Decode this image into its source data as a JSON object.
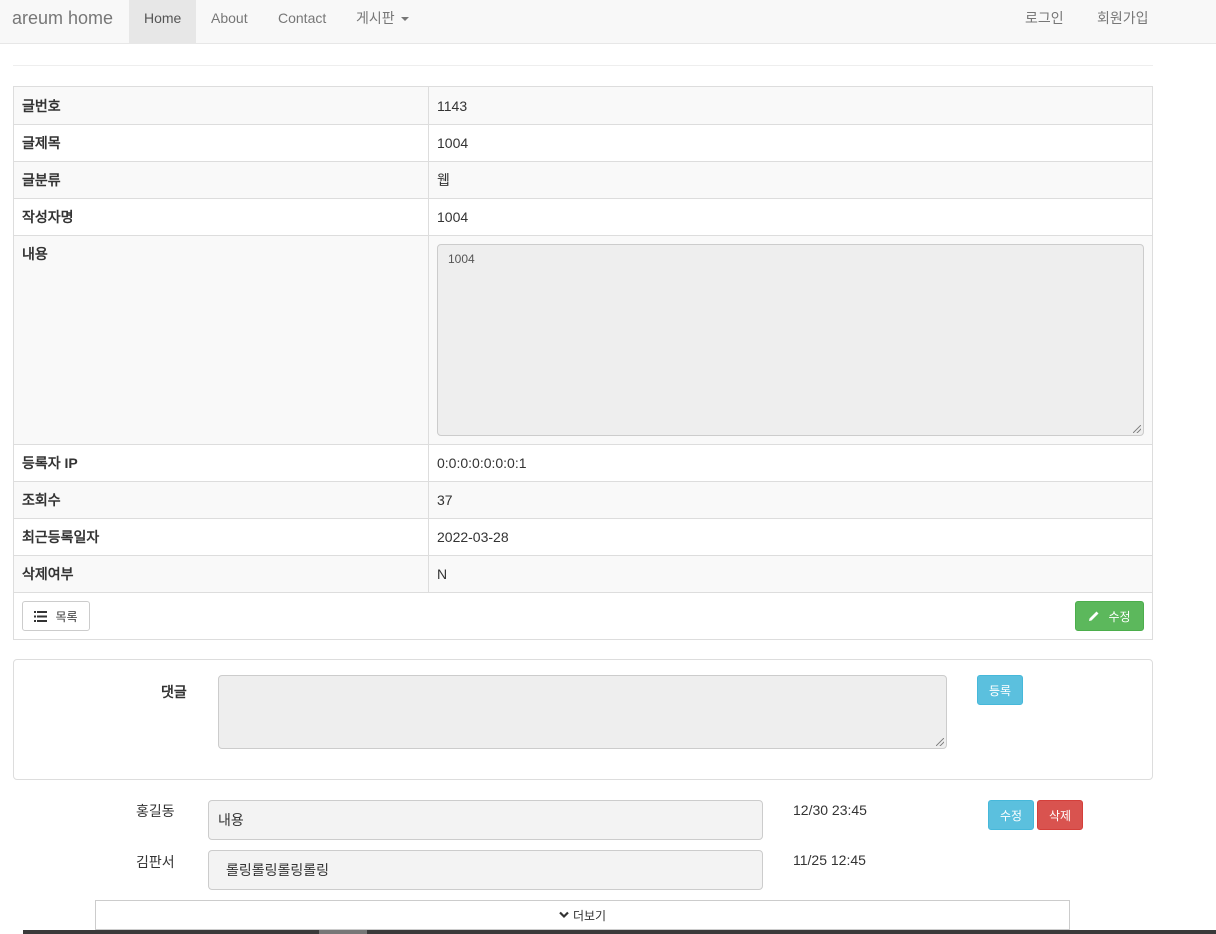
{
  "navbar": {
    "brand": "areum home",
    "items": [
      {
        "label": "Home"
      },
      {
        "label": "About"
      },
      {
        "label": "Contact"
      },
      {
        "label": "게시판"
      }
    ],
    "login": "로그인",
    "signup": "회원가입"
  },
  "detail": {
    "rows": [
      {
        "label": "글번호",
        "value": "1143"
      },
      {
        "label": "글제목",
        "value": "1004"
      },
      {
        "label": "글분류",
        "value": "웹"
      },
      {
        "label": "작성자명",
        "value": "1004"
      },
      {
        "label": "내용",
        "value": "1004"
      },
      {
        "label": "등록자 IP",
        "value": "0:0:0:0:0:0:0:1"
      },
      {
        "label": "조회수",
        "value": "37"
      },
      {
        "label": "최근등록일자",
        "value": "2022-03-28"
      },
      {
        "label": "삭제여부",
        "value": "N"
      }
    ],
    "list_button": "목록",
    "edit_button": "수정"
  },
  "comment_form": {
    "label": "댓글",
    "submit": "등록"
  },
  "comments": [
    {
      "author": "홍길동",
      "content": "내용",
      "date": "12/30 23:45",
      "edit": "수정",
      "delete": "삭제"
    },
    {
      "author": "김판서",
      "content": "롤링롤링롤링롤링",
      "date": "11/25 12:45"
    }
  ],
  "more_button": "더보기",
  "icons": {
    "list": "list-icon",
    "edit": "pencil-icon",
    "more": "chevron-down-icon",
    "caret": "caret-down-icon"
  },
  "colors": {
    "success": "#5cb85c",
    "info": "#5bc0de",
    "danger": "#d9534f"
  }
}
